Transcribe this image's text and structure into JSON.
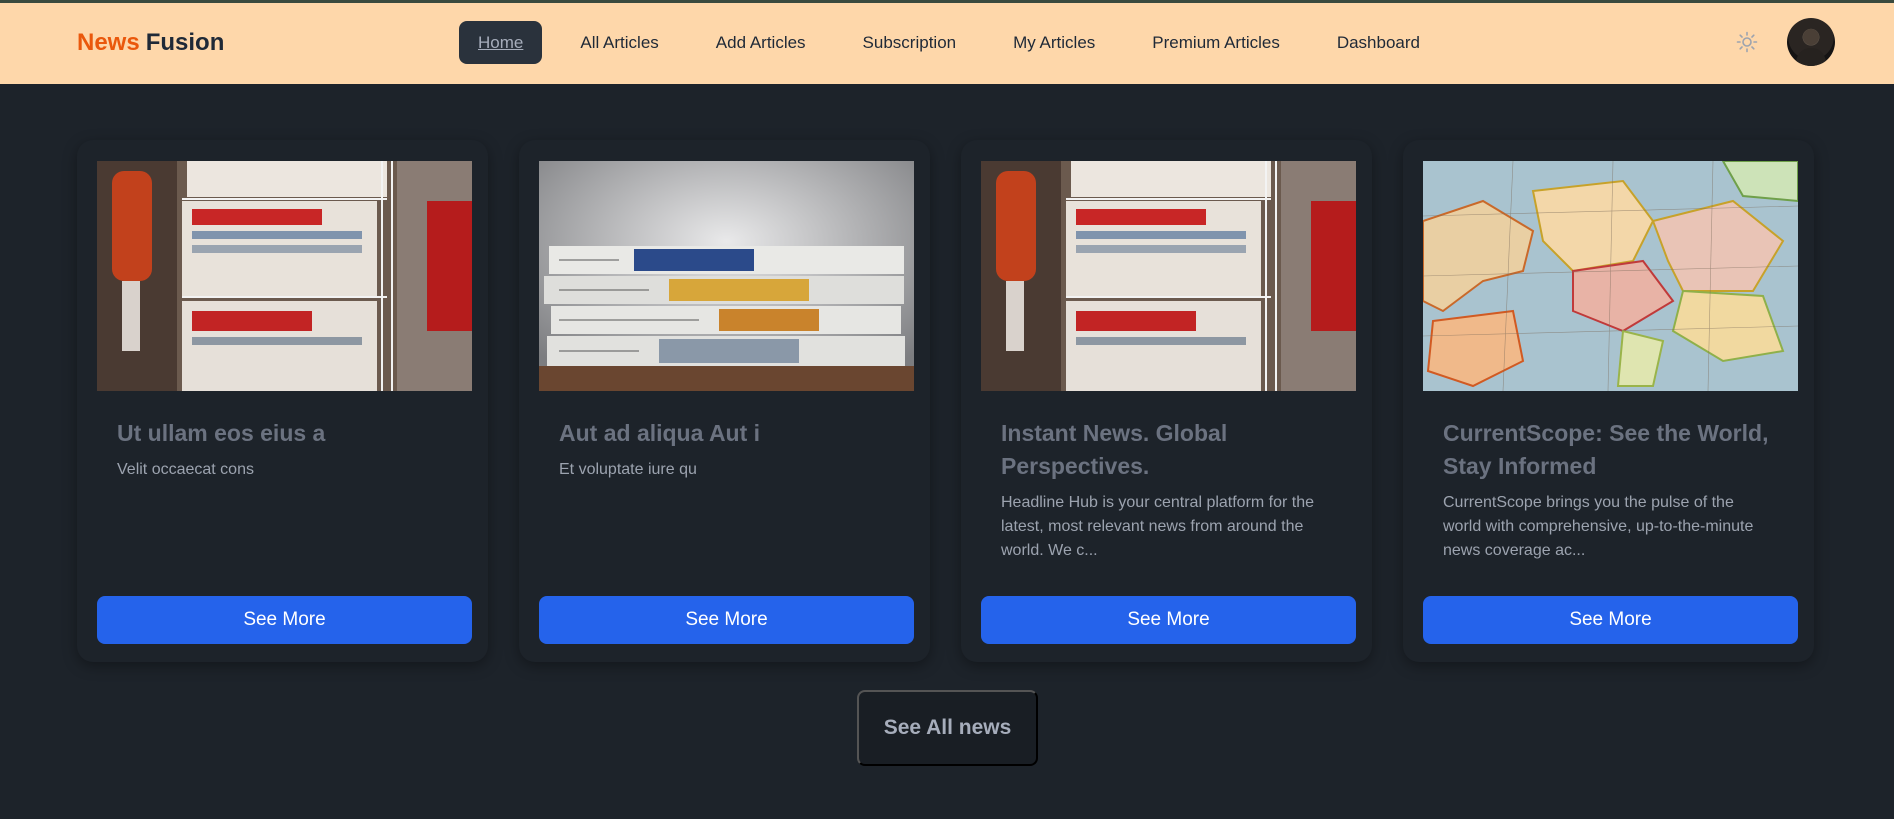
{
  "brand": {
    "part1": "News",
    "part2": "Fusion"
  },
  "nav": {
    "items": [
      {
        "label": "Home",
        "active": true
      },
      {
        "label": "All Articles"
      },
      {
        "label": "Add Articles"
      },
      {
        "label": "Subscription"
      },
      {
        "label": "My Articles"
      },
      {
        "label": "Premium Articles"
      },
      {
        "label": "Dashboard"
      }
    ]
  },
  "icons": {
    "theme": "sun-icon",
    "avatar": "user-avatar"
  },
  "cards": [
    {
      "title": "Ut ullam eos eius a",
      "desc": "Velit occaecat cons",
      "button": "See More",
      "image": "newspaper-rack"
    },
    {
      "title": "Aut ad aliqua Aut i",
      "desc": "Et voluptate iure qu",
      "button": "See More",
      "image": "newspaper-stack"
    },
    {
      "title": "Instant News. Global Perspectives.",
      "desc": "Headline Hub is your central platform for the latest, most relevant news from around the world. We c...",
      "button": "See More",
      "image": "newspaper-rack"
    },
    {
      "title": "CurrentScope: See the World, Stay Informed",
      "desc": "CurrentScope brings you the pulse of the world with comprehensive, up-to-the-minute news coverage ac...",
      "button": "See More",
      "image": "europe-map"
    }
  ],
  "see_all": "See All news",
  "colors": {
    "navbar_bg": "#fed7aa",
    "brand_accent": "#ea580c",
    "page_bg": "#1d232a",
    "button_primary": "#2563eb"
  }
}
